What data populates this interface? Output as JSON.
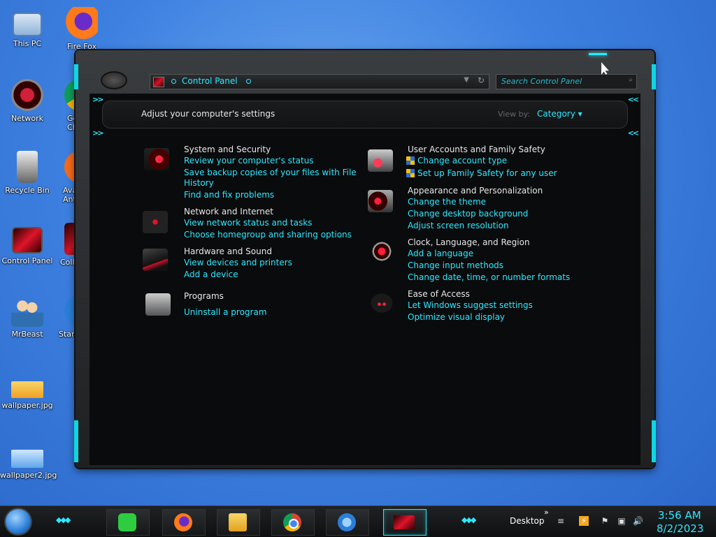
{
  "desktop": {
    "icons": [
      {
        "label": "This PC"
      },
      {
        "label": "Fire Fox"
      },
      {
        "label": "Network"
      },
      {
        "label": "Go\nChr"
      },
      {
        "label": "Recycle Bin"
      },
      {
        "label": "Avas\nAnt"
      },
      {
        "label": "Control Panel"
      },
      {
        "label": "Collab"
      },
      {
        "label": "MrBeast"
      },
      {
        "label": "Start"
      },
      {
        "label": "wallpaper.jpg"
      },
      {
        "label": "wallpaper2.jpg"
      }
    ]
  },
  "window": {
    "address": {
      "crumb": "Control Panel"
    },
    "search": {
      "placeholder": "Search Control Panel"
    },
    "heading": "Adjust your computer's settings",
    "view_by_label": "View by:",
    "view_by_value": "Category ▾"
  },
  "categories": {
    "system": {
      "title": "System and Security",
      "links": [
        "Review your computer's status",
        "Save backup copies of your files with File",
        "History",
        "Find and fix problems"
      ]
    },
    "network": {
      "title": "Network and Internet",
      "links": [
        "View network status and tasks",
        "Choose homegroup and sharing options"
      ]
    },
    "hardware": {
      "title": "Hardware and Sound",
      "links": [
        "View devices and printers",
        "Add a device"
      ]
    },
    "programs": {
      "title": "Programs",
      "links": [
        "Uninstall a program"
      ]
    },
    "users": {
      "title": "User Accounts and Family Safety",
      "links": [
        "Change account type",
        "Set up Family Safety for any user"
      ]
    },
    "appearance": {
      "title": "Appearance and Personalization",
      "links": [
        "Change the theme",
        "Change desktop background",
        "Adjust screen resolution"
      ]
    },
    "clock": {
      "title": "Clock, Language, and Region",
      "links": [
        "Add a language",
        "Change input methods",
        "Change date, time, or number formats"
      ]
    },
    "ease": {
      "title": "Ease of Access",
      "links": [
        "Let Windows suggest settings",
        "Optimize visual display"
      ]
    }
  },
  "taskbar": {
    "tray_label": "Desktop",
    "tray_chevron": "»",
    "time": "3:56 AM",
    "date": "8/2/2023"
  }
}
